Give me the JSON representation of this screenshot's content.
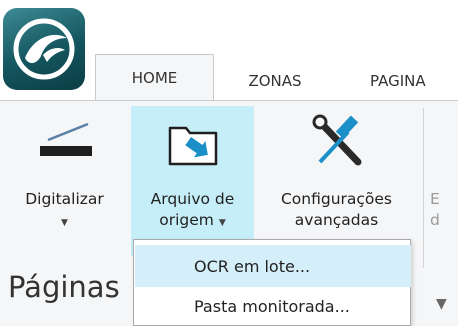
{
  "tabs": [
    {
      "label": "HOME",
      "active": true
    },
    {
      "label": "ZONAS"
    },
    {
      "label": "PAGINA"
    }
  ],
  "ribbon": {
    "scan_button": {
      "label": "Digitalizar",
      "icon": "scanner-icon"
    },
    "file_button": {
      "label_line1": "Arquivo de",
      "label_line2": "origem",
      "icon": "open-folder-icon"
    },
    "settings_button": {
      "label_line1": "Configurações",
      "label_line2": "avançadas",
      "icon": "wrench-screwdriver-icon"
    },
    "partial_button": {
      "line1": "E",
      "line2": "d"
    }
  },
  "pages_pane": {
    "title": "Páginas"
  },
  "dropdown": {
    "items": [
      {
        "label": "OCR em lote...",
        "highlighted": true
      },
      {
        "label": "Pasta monitorada..."
      }
    ]
  },
  "colors": {
    "accent_highlight": "#c6eef8",
    "menu_hover": "#d5effa",
    "logo": "#1a5f69",
    "icon_blue": "#1a8fc8"
  }
}
